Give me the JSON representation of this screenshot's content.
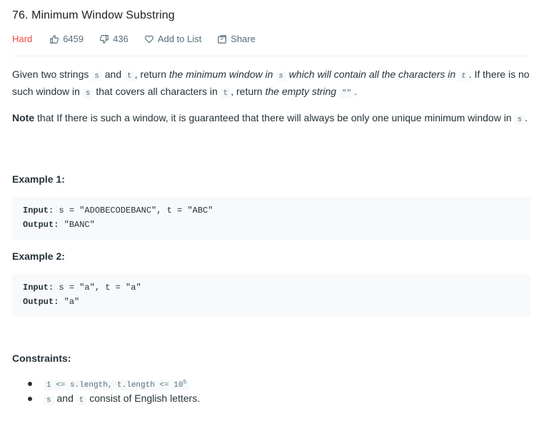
{
  "problem": {
    "title": "76. Minimum Window Substring",
    "difficulty": "Hard",
    "likes": "6459",
    "dislikes": "436",
    "add_to_list": "Add to List",
    "share": "Share"
  },
  "description": {
    "p1_a": "Given two strings ",
    "p1_code_s": "s",
    "p1_b": " and ",
    "p1_code_t": "t",
    "p1_c": ", return ",
    "p1_em1": "the minimum window in ",
    "p1_em_code_s": "s",
    "p1_em2": " which will contain all the characters in ",
    "p1_em_code_t": "t",
    "p1_d": ". If there is no such window in ",
    "p1_code_s2": "s",
    "p1_e": " that covers all characters in ",
    "p1_code_t2": "t",
    "p1_f": ", return ",
    "p1_em3": "the empty string",
    "p1_code_empty": "\"\"",
    "p1_g": ".",
    "p2_strong": "Note",
    "p2_text": " that If there is such a window, it is guaranteed that there will always be only one unique minimum window in ",
    "p2_code_s": "s",
    "p2_end": "."
  },
  "examples": [
    {
      "title": "Example 1:",
      "input_label": "Input:",
      "input_value": " s = \"ADOBECODEBANC\", t = \"ABC\"",
      "output_label": "Output:",
      "output_value": " \"BANC\""
    },
    {
      "title": "Example 2:",
      "input_label": "Input:",
      "input_value": " s = \"a\", t = \"a\"",
      "output_label": "Output:",
      "output_value": " \"a\""
    }
  ],
  "constraints": {
    "title": "Constraints:",
    "c1_code": "1 <= s.length, t.length <= 10",
    "c1_sup": "5",
    "c2_code_s": "s",
    "c2_and": " and ",
    "c2_code_t": "t",
    "c2_text": " consist of English letters."
  },
  "colors": {
    "hard": "#ef4743",
    "code_bg": "#f7f9fa",
    "muted": "#546e7a"
  }
}
